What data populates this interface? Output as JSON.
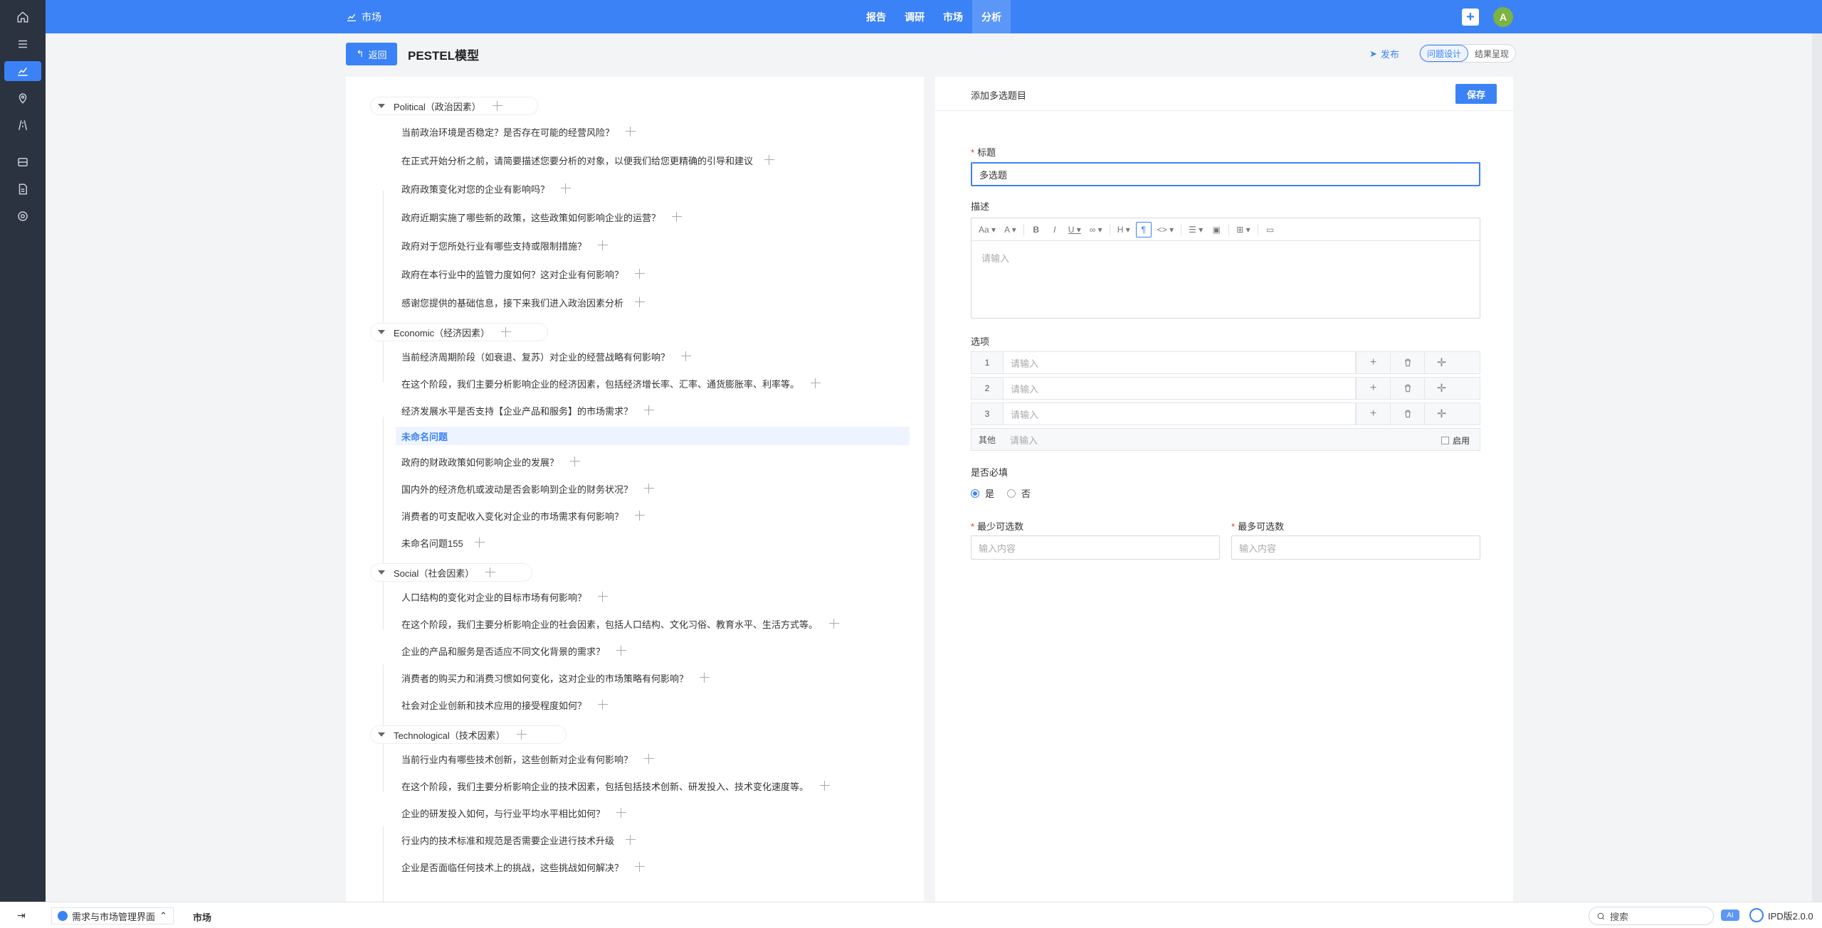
{
  "topbar": {
    "brand": "市场",
    "nav": [
      "报告",
      "调研",
      "市场",
      "分析"
    ],
    "active_nav": "分析",
    "avatar": "A"
  },
  "page": {
    "back_label": "返回",
    "title": "PESTEL模型",
    "publish_label": "发布",
    "segments": [
      "问题设计",
      "结果呈现"
    ]
  },
  "tree": {
    "groups": [
      {
        "label": "Political（政治因素）",
        "items": [
          "当前政治环境是否稳定？是否存在可能的经营风险？",
          "在正式开始分析之前，请简要描述您要分析的对象，以便我们给您更精确的引导和建议",
          "政府政策变化对您的企业有影响吗？",
          "政府近期实施了哪些新的政策，这些政策如何影响企业的运营？",
          "政府对于您所处行业有哪些支持或限制措施？",
          "政府在本行业中的监管力度如何？这对企业有何影响？",
          "感谢您提供的基础信息，接下来我们进入政治因素分析"
        ]
      },
      {
        "label": "Economic（经济因素）",
        "items": [
          "当前经济周期阶段（如衰退、复苏）对企业的经营战略有何影响？",
          "在这个阶段，我们主要分析影响企业的经济因素，包括经济增长率、汇率、通货膨胀率、利率等。",
          "经济发展水平是否支持【企业产品和服务】的市场需求？",
          "未命名问题",
          "政府的财政政策如何影响企业的发展？",
          "国内外的经济危机或波动是否会影响到企业的财务状况？",
          "消费者的可支配收入变化对企业的市场需求有何影响？",
          "未命名问题155"
        ]
      },
      {
        "label": "Social（社会因素）",
        "items": [
          "人口结构的变化对企业的目标市场有何影响？",
          "在这个阶段，我们主要分析影响企业的社会因素，包括人口结构、文化习俗、教育水平、生活方式等。",
          "企业的产品和服务是否适应不同文化背景的需求？",
          "消费者的购买力和消费习惯如何变化，这对企业的市场策略有何影响？",
          "社会对企业创新和技术应用的接受程度如何？"
        ]
      },
      {
        "label": "Technological（技术因素）",
        "items": [
          "当前行业内有哪些技术创新，这些创新对企业有何影响？",
          "在这个阶段，我们主要分析影响企业的技术因素，包括包括技术创新、研发投入、技术变化速度等。",
          "企业的研发投入如何，与行业平均水平相比如何？",
          "行业内的技术标准和规范是否需要企业进行技术升级",
          "企业是否面临任何技术上的挑战，这些挑战如何解决？"
        ]
      }
    ]
  },
  "form": {
    "header_title": "添加多选题目",
    "save_label": "保存",
    "title_label": "标题",
    "title_value": "多选题",
    "desc_label": "描述",
    "desc_placeholder": "请输入",
    "options_label": "选项",
    "options": [
      {
        "num": "1",
        "placeholder": "请输入"
      },
      {
        "num": "2",
        "placeholder": "请输入"
      },
      {
        "num": "3",
        "placeholder": "请输入"
      }
    ],
    "other_label": "其他",
    "other_placeholder": "请输入",
    "enable_label": "启用",
    "required_label": "是否必填",
    "yes_label": "是",
    "no_label": "否",
    "min_label": "最少可选数",
    "max_label": "最多可选数",
    "min_placeholder": "输入内容",
    "max_placeholder": "输入内容"
  },
  "bottombar": {
    "app_label": "需求与市场管理界面",
    "tab_label": "市场",
    "search_label": "搜索",
    "ai_label": "AI",
    "version": "IPD版2.0.0"
  },
  "colors": {
    "accent": "#3b82f6",
    "rail": "#2b3340",
    "avatar": "#7cb342"
  }
}
